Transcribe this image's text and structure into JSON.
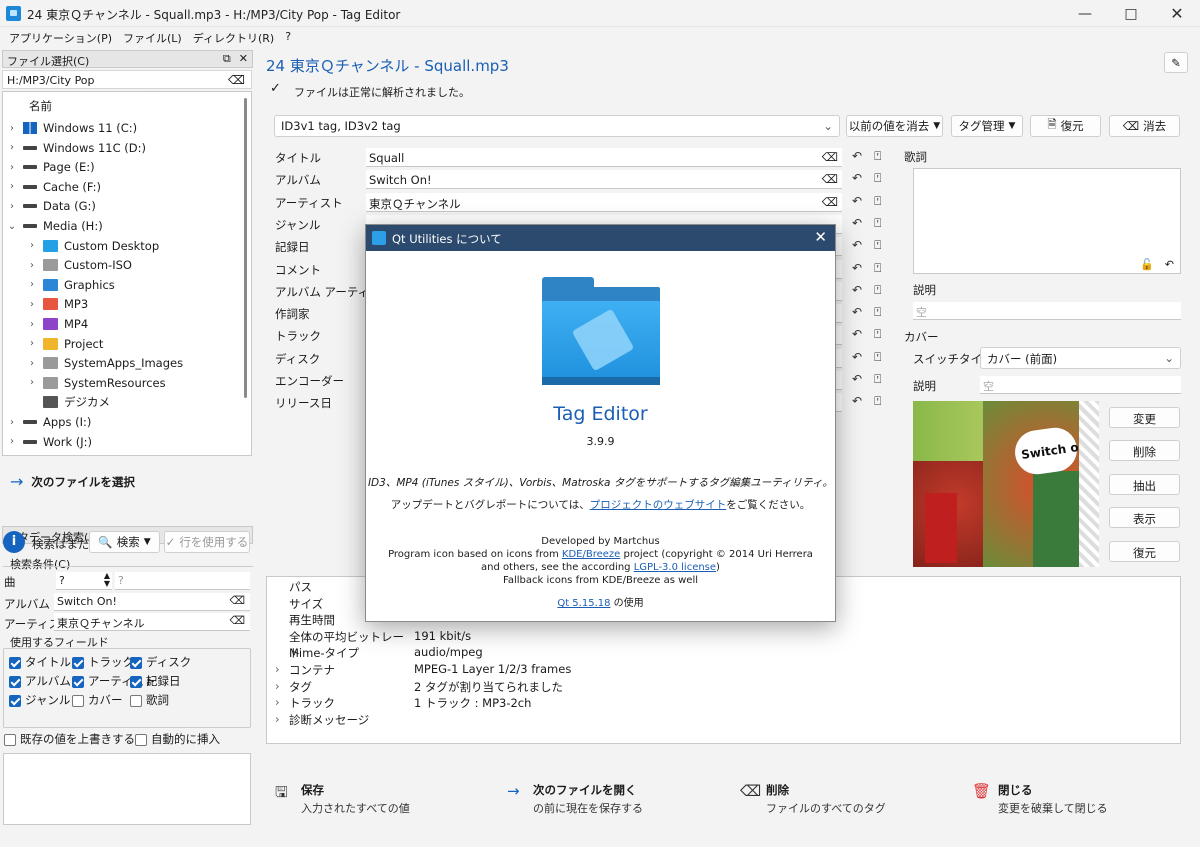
{
  "window": {
    "title": "24 東京Ｑチャンネル - Squall.mp3 - H:/MP3/City Pop - Tag Editor"
  },
  "menu": [
    "アプリケーション(P)",
    "ファイル(L)",
    "ディレクトリ(R)",
    "?"
  ],
  "file_select": {
    "title": "ファイル選択(C)",
    "path": "H:/MP3/City Pop",
    "column": "名前",
    "items": [
      {
        "label": "Windows 11 (C:)",
        "type": "win"
      },
      {
        "label": "Windows 11C (D:)",
        "type": "drive"
      },
      {
        "label": "Page (E:)",
        "type": "drive"
      },
      {
        "label": "Cache (F:)",
        "type": "drive"
      },
      {
        "label": "Data (G:)",
        "type": "drive"
      },
      {
        "label": "Media (H:)",
        "type": "drive"
      },
      {
        "label": "Custom Desktop",
        "type": "folder-blue"
      },
      {
        "label": "Custom-ISO",
        "type": "folder"
      },
      {
        "label": "Graphics",
        "type": "folder-img"
      },
      {
        "label": "MP3",
        "type": "folder-music"
      },
      {
        "label": "MP4",
        "type": "folder-video"
      },
      {
        "label": "Project",
        "type": "folder-proj"
      },
      {
        "label": "SystemApps_Images",
        "type": "folder"
      },
      {
        "label": "SystemResources",
        "type": "folder"
      },
      {
        "label": "デジカメ",
        "type": "folder-cam"
      },
      {
        "label": "Apps (I:)",
        "type": "drive"
      },
      {
        "label": "Work (J:)",
        "type": "drive"
      }
    ]
  },
  "next_file": "次のファイルを選択",
  "metadata_search": {
    "title": "メタデータ検索(M)",
    "status": "検索はまだ",
    "search_btn": "検索",
    "use_row_btn": "行を使用する",
    "criteria_label": "検索条件(C)",
    "criteria": [
      {
        "label": "曲",
        "value": "?",
        "placeholder": "?"
      },
      {
        "label": "アルバム",
        "value": "Switch On!"
      },
      {
        "label": "アーティスト",
        "value": "東京Ｑチャンネル"
      }
    ],
    "fields_label": "使用するフィールド",
    "fields": [
      {
        "label": "タイトル",
        "on": true
      },
      {
        "label": "トラック",
        "on": true
      },
      {
        "label": "ディスク",
        "on": true
      },
      {
        "label": "アルバム",
        "on": true
      },
      {
        "label": "アーティスト",
        "on": true
      },
      {
        "label": "記録日",
        "on": true
      },
      {
        "label": "ジャンル",
        "on": true
      },
      {
        "label": "カバー",
        "on": false
      },
      {
        "label": "歌詞",
        "on": false
      }
    ],
    "overwrite": "既存の値を上書きする",
    "auto_insert": "自動的に挿入"
  },
  "editor": {
    "heading": "24 東京Ｑチャンネル - Squall.mp3",
    "parse_status": "ファイルは正常に解析されました。",
    "tag_combo": "ID3v1 tag, ID3v2 tag",
    "clear_prev": "以前の値を消去",
    "tag_manage": "タグ管理",
    "restore": "復元",
    "delete": "消去",
    "fields": [
      {
        "label": "タイトル",
        "value": "Squall"
      },
      {
        "label": "アルバム",
        "value": "Switch On!"
      },
      {
        "label": "アーティスト",
        "value": "東京Ｑチャンネル"
      },
      {
        "label": "ジャンル",
        "value": ""
      },
      {
        "label": "記録日",
        "value": ""
      },
      {
        "label": "コメント",
        "value": ""
      },
      {
        "label": "アルバム アーティスト",
        "value": ""
      },
      {
        "label": "作詞家",
        "value": ""
      },
      {
        "label": "トラック",
        "value": ""
      },
      {
        "label": "ディスク",
        "value": ""
      },
      {
        "label": "エンコーダー",
        "value": ""
      },
      {
        "label": "リリース日",
        "value": ""
      }
    ],
    "lyrics_label": "歌詞",
    "desc_label": "説明",
    "desc_placeholder": "空",
    "cover_label": "カバー",
    "switch_type_label": "スイッチタイプ",
    "switch_type_value": "カバー (前面)",
    "cover_desc_label": "説明",
    "cover_desc_placeholder": "空",
    "cover_buttons": [
      "変更",
      "削除",
      "抽出",
      "表示",
      "復元"
    ],
    "cover_art": {
      "text": "Switch on!",
      "c1": "#8ab84a",
      "c2": "#c23b2a"
    }
  },
  "info": {
    "rows": [
      {
        "k": "パス",
        "v": "",
        "exp": false
      },
      {
        "k": "サイズ",
        "v": "",
        "exp": false
      },
      {
        "k": "再生時間",
        "v": "",
        "exp": false
      },
      {
        "k": "全体の平均ビットレート",
        "v": "191 kbit/s",
        "exp": false
      },
      {
        "k": "Mime-タイプ",
        "v": "audio/mpeg",
        "exp": false
      },
      {
        "k": "コンテナ",
        "v": "MPEG-1 Layer 1/2/3 frames",
        "exp": true
      },
      {
        "k": "タグ",
        "v": "2 タグが割り当てられました",
        "exp": true
      },
      {
        "k": "トラック",
        "v": "1 トラック : MP3-2ch",
        "exp": true
      },
      {
        "k": "診断メッセージ",
        "v": "",
        "exp": true
      }
    ]
  },
  "bottom": [
    {
      "title": "保存",
      "sub": "入力されたすべての値",
      "icon": "save-icon",
      "glyph": "🖫"
    },
    {
      "title": "次のファイルを開く",
      "sub": "の前に現在を保存する",
      "icon": "arrow-right-icon",
      "glyph": "→"
    },
    {
      "title": "削除",
      "sub": "ファイルのすべてのタグ",
      "icon": "backspace-icon",
      "glyph": "⌫"
    },
    {
      "title": "閉じる",
      "sub": "変更を破棄して閉じる",
      "icon": "trash-icon",
      "glyph": "🗑"
    }
  ],
  "dialog": {
    "title": "Qt Utilities について",
    "app_name": "Tag Editor",
    "version": "3.9.9",
    "desc": "ID3、MP4 (iTunes スタイル)、Vorbis、Matroska タグをサポートするタグ編集ユーティリティ。",
    "update_pre": "アップデートとバグレポートについては、",
    "update_link": "プロジェクトのウェブサイト",
    "update_post": "をご覧ください。",
    "dev": "Developed by Martchus",
    "icon1_pre": "Program icon based on icons from ",
    "icon1_link": "KDE/Breeze",
    "icon1_post": " project (copyright © 2014 Uri Herrera",
    "icon2_pre": "and others, see the according ",
    "icon2_link": "LGPL-3.0 license",
    "icon2_post": ")",
    "icon3": "Fallback icons from KDE/Breeze as well",
    "qt_link": "Qt 5.15.18",
    "qt_post": " の使用"
  }
}
